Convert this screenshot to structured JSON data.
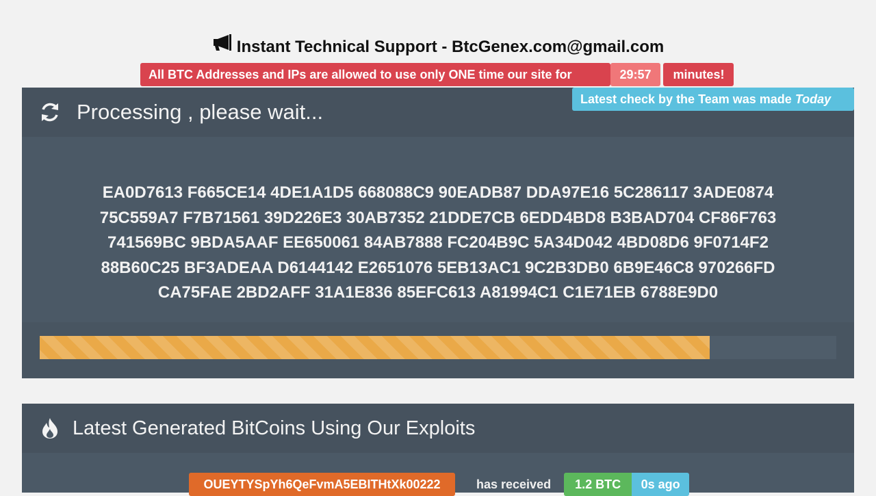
{
  "header": {
    "support_icon": "bullhorn-icon",
    "support_text": "Instant Technical Support - BtcGenex.com@gmail.com"
  },
  "alert": {
    "message": "All BTC Addresses and IPs are allowed to use only ONE time our site for",
    "timer": "29:57",
    "suffix": "minutes!"
  },
  "team_badge": {
    "text": "Latest check by the Team was made",
    "emphasis": "Today"
  },
  "processing": {
    "icon": "refresh-icon",
    "title": "Processing , please wait...",
    "hex_lines": [
      "EA0D7613 F665CE14 4DE1A1D5 668088C9 90EADB87 DDA97E16 5C286117 3ADE0874",
      "75C559A7 F7B71561 39D226E3 30AB7352 21DDE7CB 6EDD4BD8 B3BAD704 CF86F763",
      "741569BC 9BDA5AAF EE650061 84AB7888 FC204B9C 5A34D042 4BD08D6 9F0714F2",
      "88B60C25 BF3ADEAA D6144142 E2651076 5EB13AC1 9C2B3DB0 6B9E46C8 970266FD",
      "CA75FAE 2BD2AFF 31A1E836 85EFC613 A81994C1 C1E71EB 6788E9D0"
    ],
    "progress_fraction": 0.841
  },
  "latest": {
    "icon": "fire-icon",
    "title": "Latest Generated BitCoins Using Our Exploits",
    "entry": {
      "address": "OUEYTYSpYh6QeFvmA5EBITHtXk00222",
      "verb": "has received",
      "amount": "1.2 BTC",
      "age": "0s ago"
    }
  },
  "colors": {
    "danger": "#d9434e",
    "timer": "#f07779",
    "info": "#5bc0de",
    "success": "#5cb85c",
    "warning": "#e06a29",
    "progress": "#eaa948",
    "panel": "#4b5966"
  }
}
